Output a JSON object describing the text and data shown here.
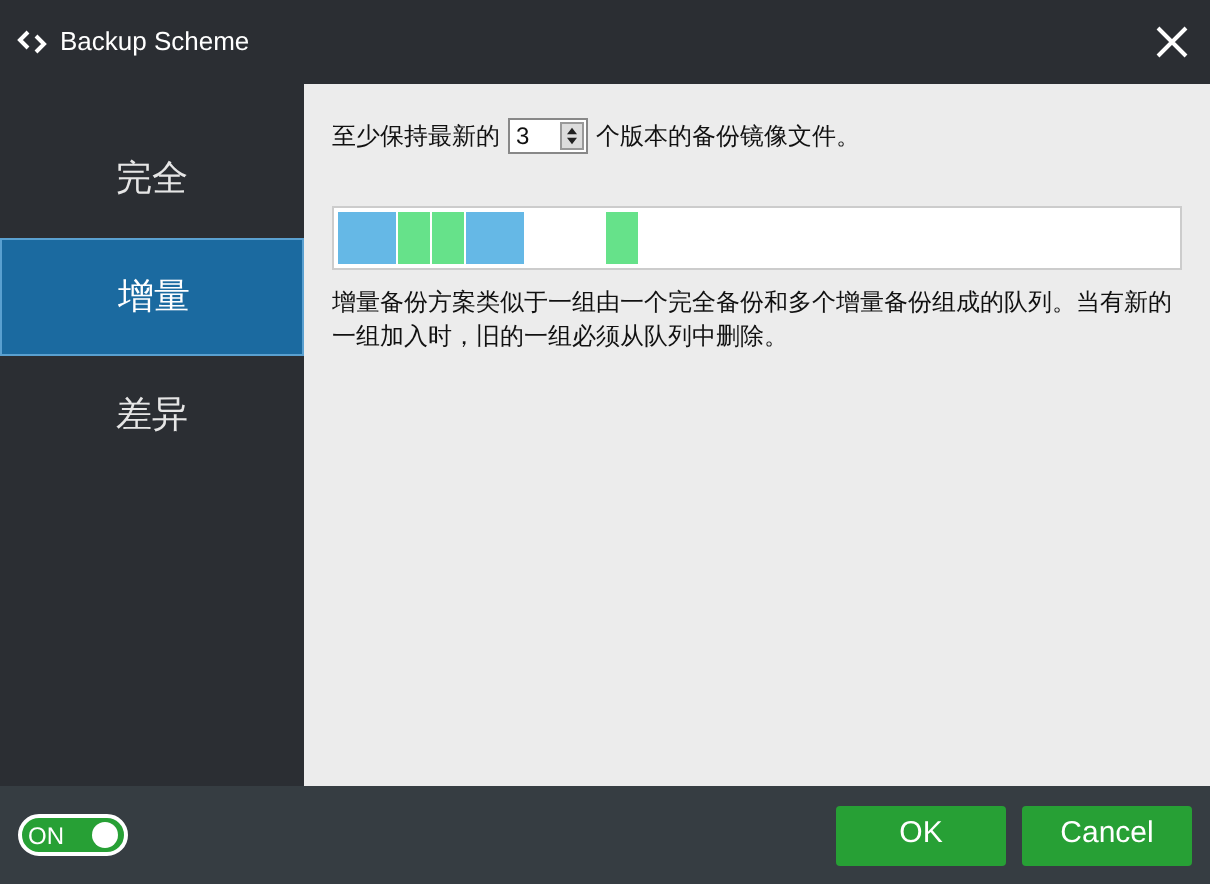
{
  "window": {
    "title": "Backup Scheme"
  },
  "sidebar": {
    "items": [
      {
        "label": "完全",
        "selected": false
      },
      {
        "label": "增量",
        "selected": true
      },
      {
        "label": "差异",
        "selected": false
      }
    ]
  },
  "retention": {
    "prefix": "至少保持最新的",
    "value": "3",
    "suffix": "个版本的备份镜像文件。"
  },
  "queue": {
    "segments": [
      {
        "kind": "full"
      },
      {
        "kind": "incremental"
      },
      {
        "kind": "incremental"
      },
      {
        "kind": "full"
      },
      {
        "kind": "empty"
      },
      {
        "kind": "incremental"
      }
    ]
  },
  "description": "增量备份方案类似于一组由一个完全备份和多个增量备份组成的队列。当有新的一组加入时，旧的一组必须从队列中删除。",
  "footer": {
    "toggle": {
      "label": "ON",
      "on": true
    },
    "buttons": [
      "OK",
      "Cancel"
    ]
  }
}
